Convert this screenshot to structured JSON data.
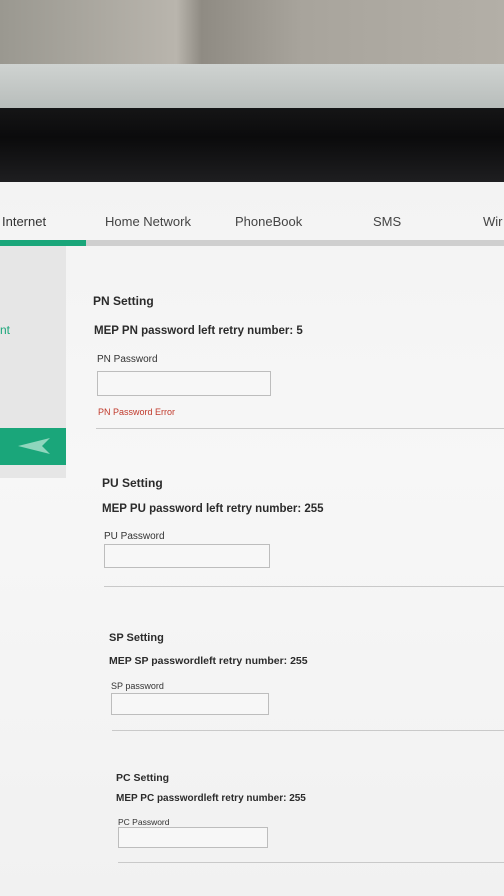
{
  "nav": {
    "items": [
      "Internet",
      "Home Network",
      "PhoneBook",
      "SMS",
      "Wir"
    ]
  },
  "sidebar": {
    "label": "nt"
  },
  "sections": [
    {
      "title": "PN Setting",
      "retry": "MEP PN password left retry number: 5",
      "field_label": "PN Password",
      "error": "PN Password Error"
    },
    {
      "title": "PU Setting",
      "retry": "MEP PU password left retry number: 255",
      "field_label": "PU Password"
    },
    {
      "title": "SP Setting",
      "retry": "MEP SP passwordleft retry number: 255",
      "field_label": "SP password"
    },
    {
      "title": "PC Setting",
      "retry": "MEP PC passwordleft retry number: 255",
      "field_label": "PC Password"
    }
  ],
  "colors": {
    "accent": "#1aa67a",
    "error": "#c0392b"
  }
}
